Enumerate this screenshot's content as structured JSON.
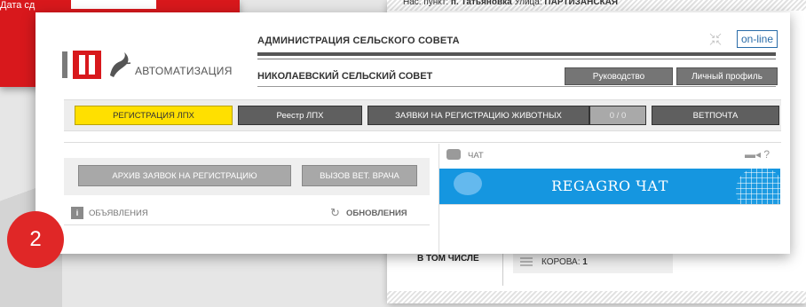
{
  "background": {
    "red_panel_label": "Дата сд",
    "header_text_prefix": "Нас. пункт:",
    "header_village": "п. Татьяновка",
    "header_street_label": "Улица:",
    "header_street": "ПАРТИЗАНСКАЯ",
    "including_label": "В ТОМ ЧИСЛЕ",
    "cow_label": "КОРОВА:",
    "cow_count": "1"
  },
  "header": {
    "logo_text": "АВТОМАТИЗАЦИЯ",
    "admin_title": "АДМИНИСТРАЦИЯ СЕЛЬСКОГО СОВЕТА",
    "council_title": "НИКОЛАЕВСКИЙ СЕЛЬСКИЙ СОВЕТ",
    "online_label": "on-line",
    "leadership_button": "Руководство",
    "profile_button": "Личный профиль"
  },
  "nav": {
    "registration": "РЕГИСТРАЦИЯ ЛПХ",
    "registry": "Реестр ЛПХ",
    "animal_requests": "ЗАЯВКИ НА РЕГИСТРАЦИЮ ЖИВОТНЫХ",
    "counter": "0 / 0",
    "vetmail": "ВЕТПОЧТА"
  },
  "left_panel": {
    "archive_button": "АРХИВ ЗАЯВОК НА РЕГИСТРАЦИЮ",
    "vet_button": "ВЫЗОВ ВЕТ. ВРАЧА",
    "announcements": "ОБЪЯВЛЕНИЯ",
    "updates": "ОБНОВЛЕНИЯ"
  },
  "chat": {
    "label": "ЧАТ",
    "banner_title": "REGAGRO ЧАТ"
  },
  "step_badge": "2",
  "colors": {
    "brand_red": "#d8181c",
    "active_yellow": "#ffe000",
    "chat_blue": "#1596e0",
    "online_blue": "#2a6ca8"
  }
}
